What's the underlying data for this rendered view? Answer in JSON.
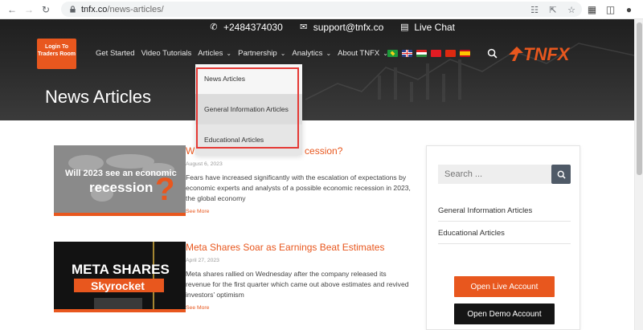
{
  "browser": {
    "url_host": "tnfx.co",
    "url_path": "/news-articles/"
  },
  "contact": {
    "phone": "+2484374030",
    "email": "support@tnfx.co",
    "chat": "Live Chat"
  },
  "header": {
    "login_label": "Login To Traders Room",
    "page_title": "News Articles",
    "logo_text": "TNFX",
    "nav": [
      {
        "label": "Get Started",
        "has_dropdown": false
      },
      {
        "label": "Video Tutorials",
        "has_dropdown": false
      },
      {
        "label": "Articles",
        "has_dropdown": true
      },
      {
        "label": "Partnership",
        "has_dropdown": true
      },
      {
        "label": "Analytics",
        "has_dropdown": true
      },
      {
        "label": "About TNFX",
        "has_dropdown": true
      }
    ],
    "flags": [
      "br",
      "gb",
      "hu",
      "tr",
      "cn",
      "es"
    ]
  },
  "dropdown": {
    "items": [
      "News Articles",
      "General Information Articles",
      "Educational Articles"
    ]
  },
  "articles": [
    {
      "title": "Will 2023 see an economic recession?",
      "visible_title": "W                                         cession?",
      "date": "August 6, 2023",
      "excerpt": "Fears have increased significantly with the escalation of expectations by economic experts and analysts of a possible economic recession in 2023, the global economy",
      "more": "See More",
      "thumb_line1": "Will 2023 see an economic",
      "thumb_line2": "recession",
      "thumb_mark": "?"
    },
    {
      "title": "Meta Shares Soar as Earnings Beat Estimates",
      "date": "April 27, 2023",
      "excerpt": "Meta shares rallied on Wednesday after the company released its revenue for the first quarter which came out above estimates and revived investors’ optimism",
      "more": "See More",
      "thumb_line1": "META SHARES",
      "thumb_line2": "Skyrocket"
    }
  ],
  "sidebar": {
    "search_placeholder": "Search ...",
    "links": [
      "General Information Articles",
      "Educational Articles"
    ],
    "live_button": "Open Live Account",
    "demo_button": "Open Demo Account"
  },
  "colors": {
    "accent": "#e8571e",
    "header_dark": "#2a2a2a",
    "highlight": "#e53935"
  }
}
